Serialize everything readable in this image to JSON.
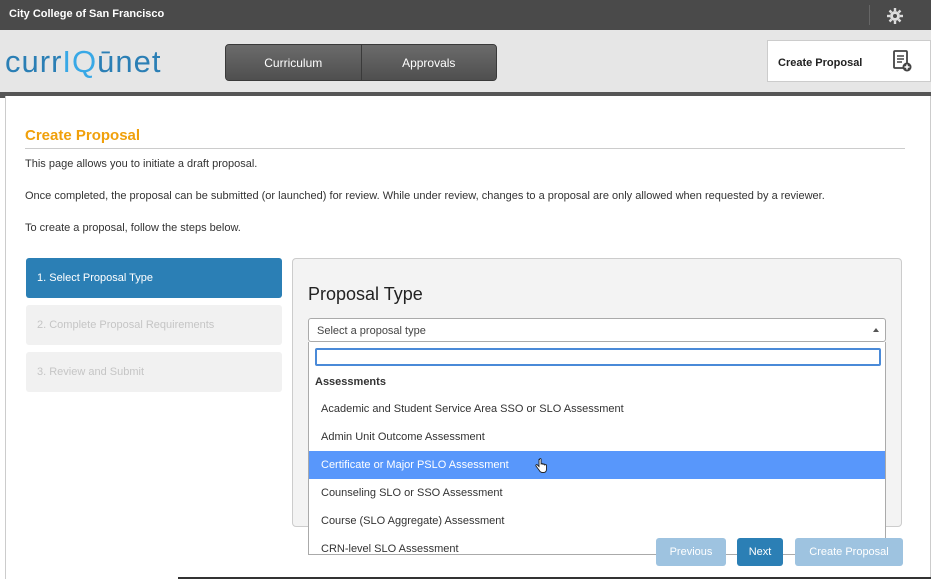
{
  "topbar": {
    "institution": "City College of San Francisco"
  },
  "header": {
    "logo_text_before": "curr",
    "logo_letter_i": "I",
    "logo_letter_q": "Q",
    "logo_text_after": "ūnet",
    "nav": [
      {
        "label": "Curriculum"
      },
      {
        "label": "Approvals"
      }
    ],
    "create_proposal_label": "Create Proposal"
  },
  "page": {
    "title": "Create Proposal",
    "paragraphs": [
      "This page allows you to initiate a draft proposal.",
      "Once completed, the proposal can be submitted (or launched) for review. While under review, changes to a proposal are only allowed when requested by a reviewer.",
      "To create a proposal, follow the steps below."
    ]
  },
  "steps": [
    {
      "label": "1. Select Proposal Type"
    },
    {
      "label": "2. Complete Proposal Requirements"
    },
    {
      "label": "3. Review and Submit"
    }
  ],
  "panel": {
    "heading": "Proposal Type",
    "select_placeholder": "Select a proposal type",
    "dropdown": {
      "search_value": "",
      "group_label": "Assessments",
      "options": [
        {
          "label": "Academic and Student Service Area SSO or SLO Assessment"
        },
        {
          "label": "Admin Unit Outcome Assessment"
        },
        {
          "label": "Certificate or Major PSLO Assessment"
        },
        {
          "label": "Counseling SLO or SSO Assessment"
        },
        {
          "label": "Course (SLO Aggregate) Assessment"
        },
        {
          "label": "CRN-level SLO Assessment"
        }
      ]
    }
  },
  "footer_buttons": {
    "previous": "Previous",
    "next": "Next",
    "create": "Create Proposal"
  },
  "colors": {
    "accent": "#2b7fb5",
    "title_orange": "#f0a00b",
    "highlight": "#5897fb"
  }
}
